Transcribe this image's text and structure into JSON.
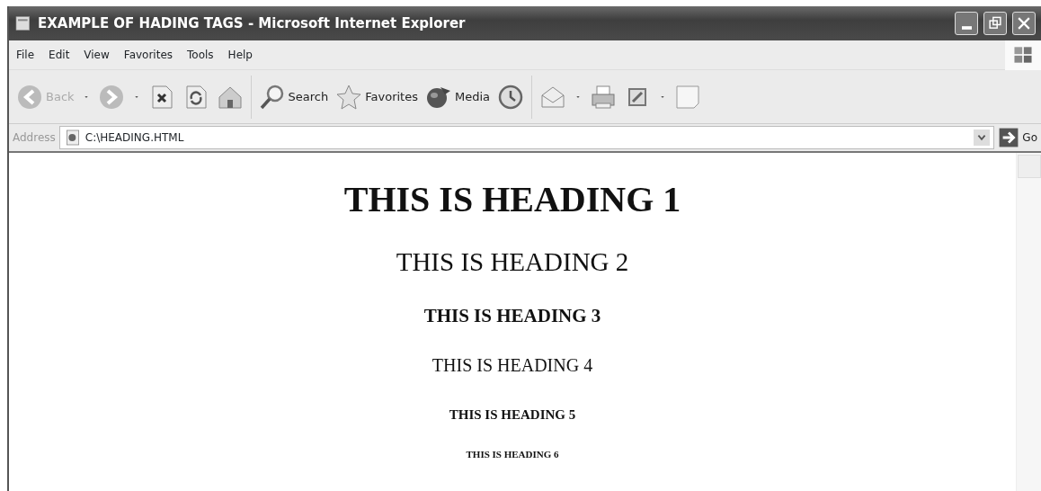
{
  "window": {
    "title": "EXAMPLE OF HADING TAGS - Microsoft Internet Explorer"
  },
  "menu": [
    "File",
    "Edit",
    "View",
    "Favorites",
    "Tools",
    "Help"
  ],
  "toolbar": [
    {
      "kind": "back",
      "label": "Back"
    },
    {
      "kind": "forward"
    },
    {
      "kind": "stop"
    },
    {
      "kind": "refresh"
    },
    {
      "kind": "home"
    },
    {
      "kind": "separator"
    },
    {
      "kind": "search",
      "label": "Search"
    },
    {
      "kind": "favorites",
      "label": "Favorites"
    },
    {
      "kind": "media",
      "label": "Media"
    },
    {
      "kind": "history"
    },
    {
      "kind": "separator"
    },
    {
      "kind": "mail"
    },
    {
      "kind": "print"
    },
    {
      "kind": "edit"
    },
    {
      "kind": "note"
    }
  ],
  "address": {
    "label": "Address",
    "value": "C:\\HEADING.HTML",
    "go": "Go"
  },
  "headings": [
    {
      "kind": "h1",
      "text": "THIS IS HEADING 1"
    },
    {
      "kind": "h2",
      "text": "THIS IS HEADING 2"
    },
    {
      "kind": "h3",
      "text": "THIS IS HEADING 3"
    },
    {
      "kind": "h4",
      "text": "THIS IS HEADING 4"
    },
    {
      "kind": "h5",
      "text": "THIS IS HEADING 5"
    },
    {
      "kind": "h6",
      "text": "THIS IS HEADING 6"
    }
  ]
}
